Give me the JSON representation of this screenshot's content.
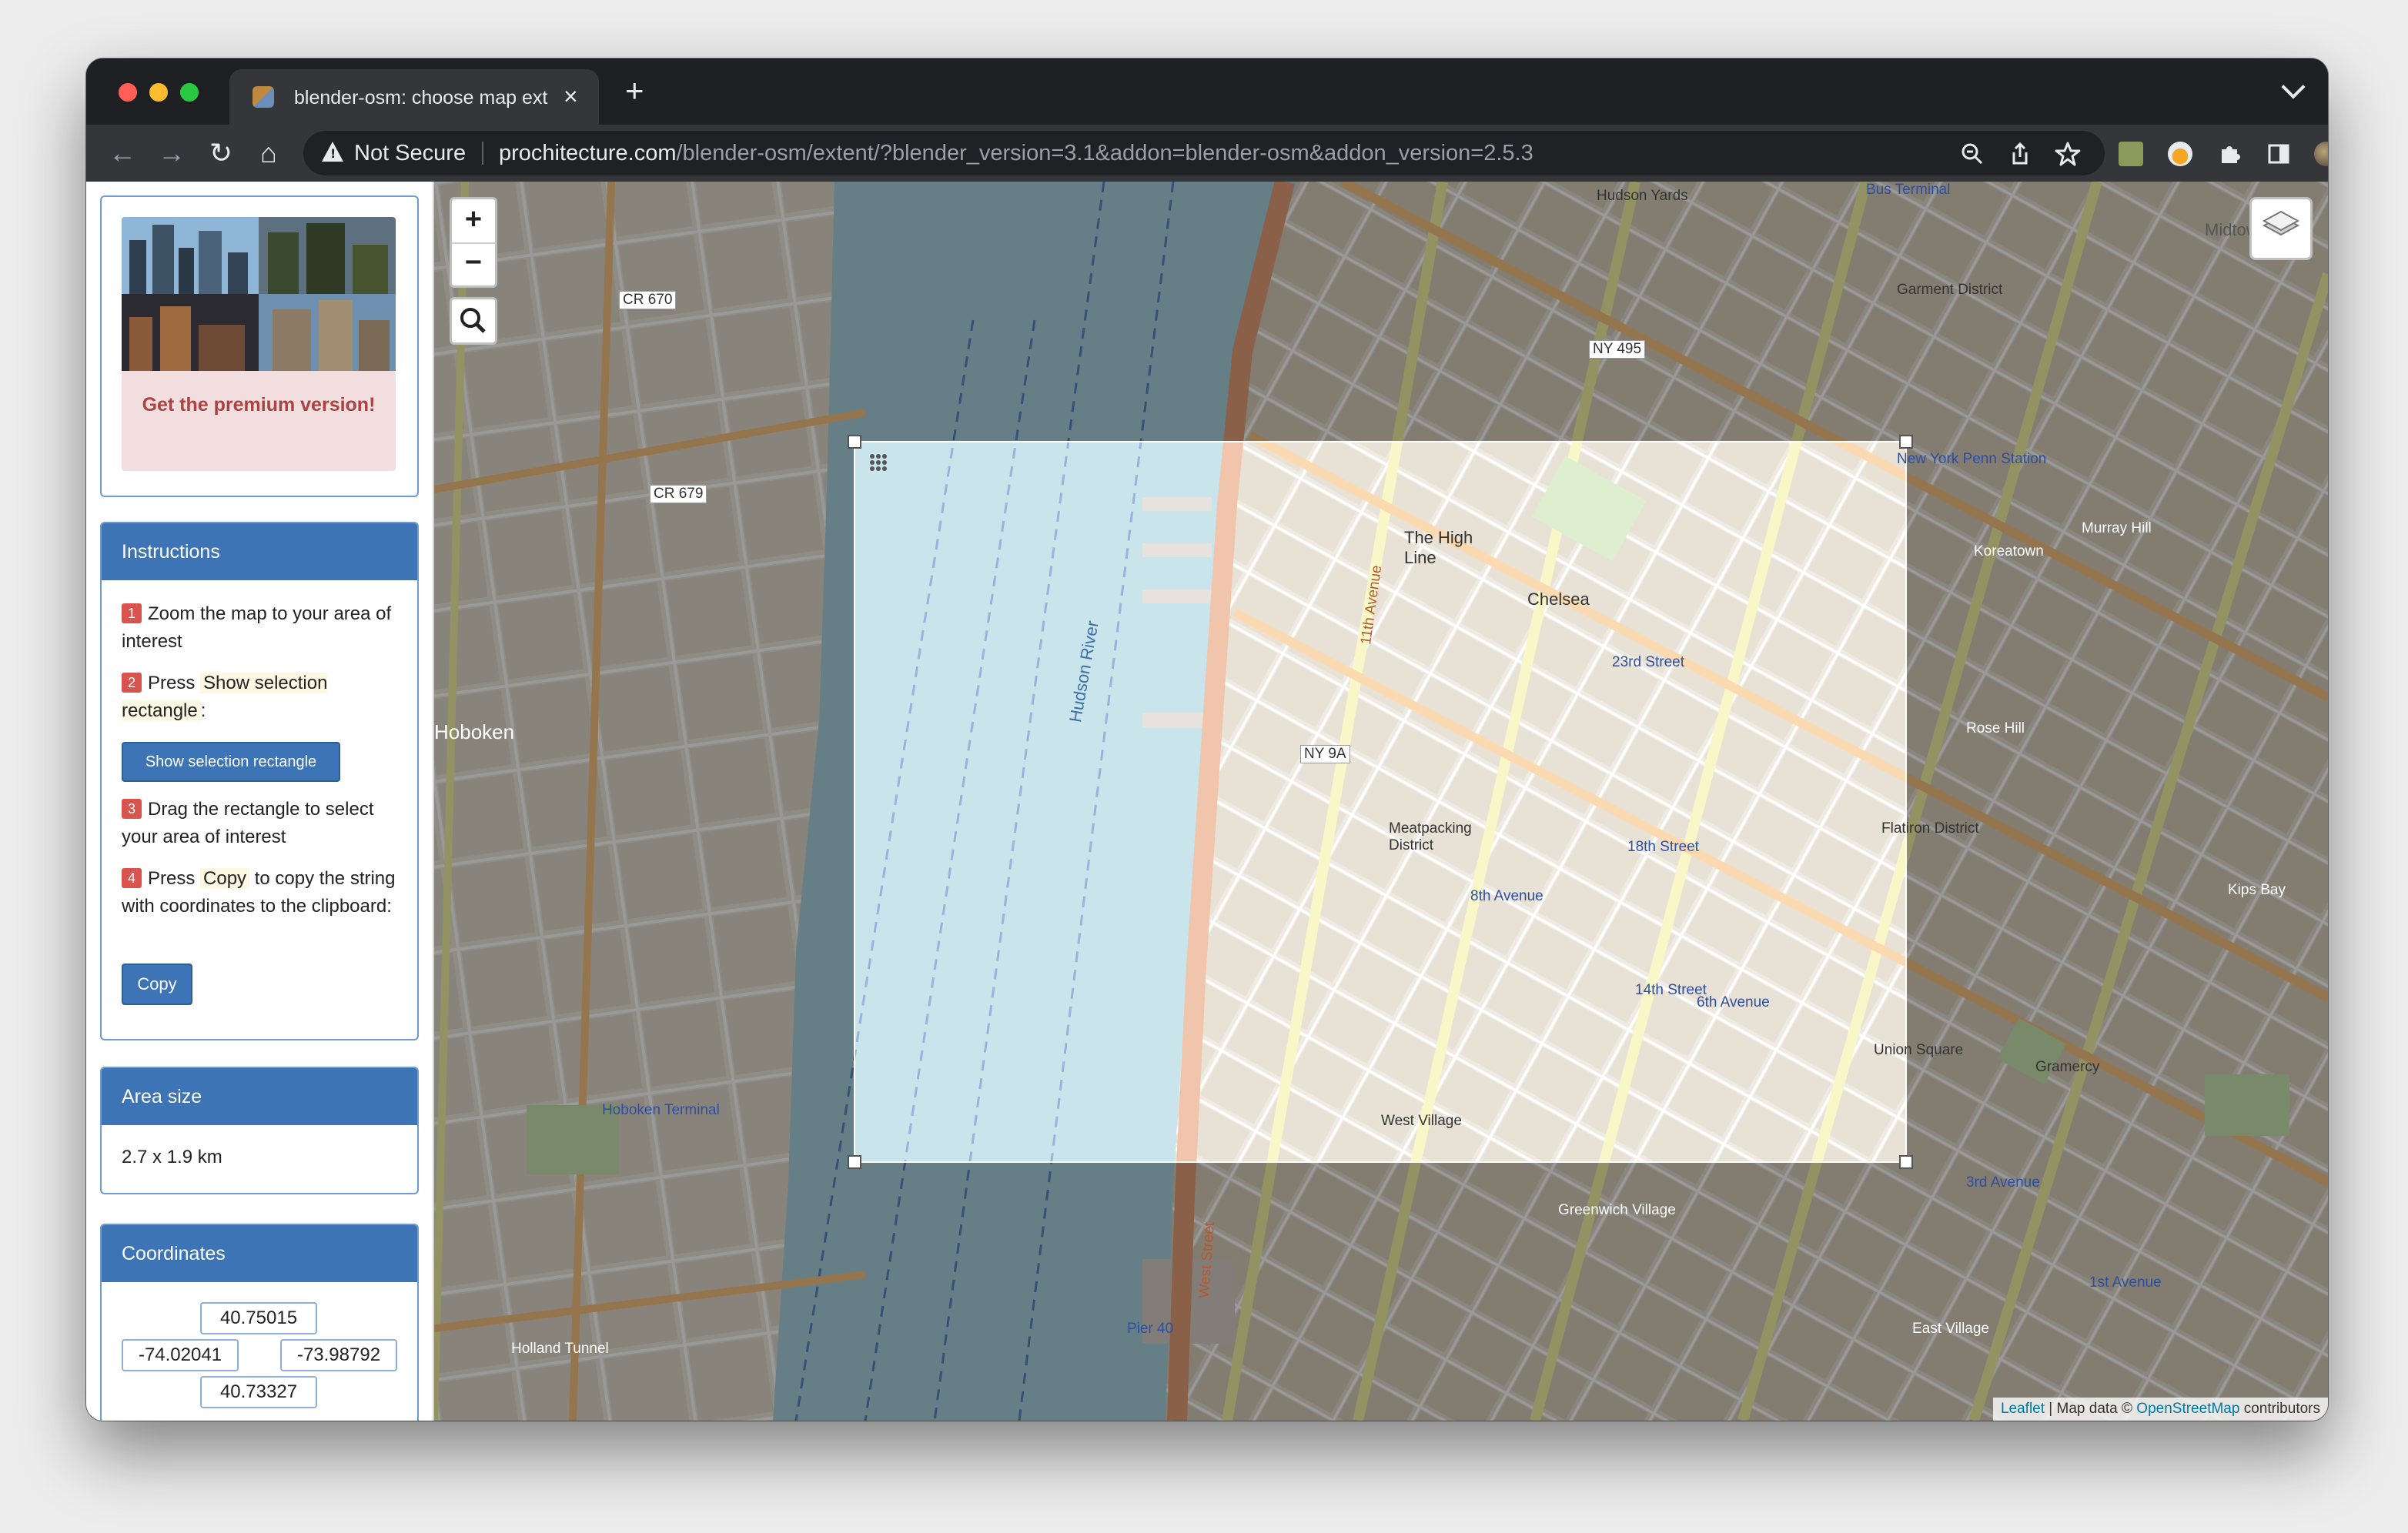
{
  "browser": {
    "tab_title": "blender-osm: choose map extent",
    "security_label": "Not Secure",
    "url_host": "prochitecture.com",
    "url_path": "/blender-osm/extent/?blender_version=3.1&addon=blender-osm&addon_version=2.5.3"
  },
  "sidebar": {
    "promo_text": "Get the premium version!",
    "instructions": {
      "title": "Instructions",
      "step1_num": "1",
      "step1_text": "Zoom the map to your area of interest",
      "step2_num": "2",
      "step2_pre": "Press",
      "step2_hl": "Show selection rectangle",
      "step2_post": ":",
      "show_rect_button": "Show selection rectangle",
      "step3_num": "3",
      "step3_text": "Drag the rectangle to select your area of interest",
      "step4_num": "4",
      "step4_pre": "Press",
      "step4_hl": "Copy",
      "step4_post": "to copy the string with coordinates to the clipboard:",
      "copy_button": "Copy"
    },
    "area_size": {
      "title": "Area size",
      "value": "2.7 x 1.9 km"
    },
    "coordinates": {
      "title": "Coordinates",
      "north": "40.75015",
      "west": "-74.02041",
      "east": "-73.98792",
      "south": "40.73327"
    }
  },
  "map": {
    "zoom_in": "+",
    "zoom_out": "−",
    "attribution_leaflet": "Leaflet",
    "attribution_mid": "| Map data ©",
    "attribution_osm": "OpenStreetMap",
    "attribution_end": "contributors",
    "labels": {
      "hudson_yards": "Hudson Yards",
      "garment_district": "Garment District",
      "midtown": "Midtown",
      "the_high_line": "The High Line",
      "chelsea": "Chelsea",
      "penn_station": "New York Penn Station",
      "meatpacking": "Meatpacking District",
      "flatiron": "Flatiron District",
      "union_square": "Union Square",
      "west_village": "West Village",
      "gramercy": "Gramercy",
      "greenwich_village": "Greenwich Village",
      "hoboken": "Hoboken",
      "hoboken_terminal": "Hoboken Terminal",
      "kips_bay": "Kips Bay",
      "murray_hill": "Murray Hill",
      "koreatown": "Koreatown",
      "hudson_river": "Hudson River",
      "eleventh_ave": "11th Avenue",
      "west_street": "West Street",
      "ny9a": "NY 9A",
      "ny495": "NY 495",
      "cr670": "CR 670",
      "cr679": "CR 679",
      "fourteenth_st": "14th Street",
      "twentythird_st": "23rd Street",
      "eighteenth_st": "18th Street",
      "eighth_ave": "8th Avenue",
      "sixth_ave": "6th Avenue",
      "bus_terminal": "Bus Terminal",
      "pier_40": "Pier 40",
      "holland_tunnel": "Holland Tunnel",
      "rose_hill": "Rose Hill",
      "east_village": "East Village",
      "first_avenue": "1st Avenue",
      "third_avenue": "3rd Avenue"
    }
  }
}
